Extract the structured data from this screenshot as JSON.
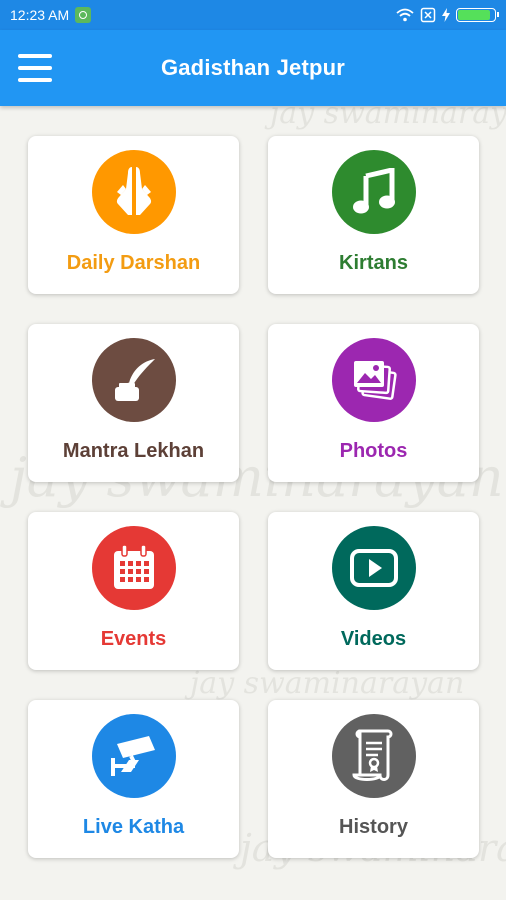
{
  "status_bar": {
    "time": "12:23 AM"
  },
  "app_bar": {
    "title": "Gadisthan Jetpur",
    "menu_icon": "hamburger-menu-icon"
  },
  "background": {
    "watermark_text": "jay swaminarayan"
  },
  "tiles": [
    {
      "label": "Daily Darshan",
      "icon": "praying-hands-icon",
      "color": "#ff9800",
      "label_color": "#f39c12"
    },
    {
      "label": "Kirtans",
      "icon": "music-note-icon",
      "color": "#2e8b2e",
      "label_color": "#2e7d32"
    },
    {
      "label": "Mantra Lekhan",
      "icon": "quill-inkpot-icon",
      "color": "#6d4c41",
      "label_color": "#5d4037"
    },
    {
      "label": "Photos",
      "icon": "photos-icon",
      "color": "#9c27b0",
      "label_color": "#9c27b0"
    },
    {
      "label": "Events",
      "icon": "calendar-icon",
      "color": "#e53935",
      "label_color": "#e53935"
    },
    {
      "label": "Videos",
      "icon": "play-video-icon",
      "color": "#00695c",
      "label_color": "#00695c"
    },
    {
      "label": "Live Katha",
      "icon": "cctv-camera-icon",
      "color": "#1e88e5",
      "label_color": "#1e88e5"
    },
    {
      "label": "History",
      "icon": "scroll-certificate-icon",
      "color": "#616161",
      "label_color": "#555555"
    }
  ]
}
